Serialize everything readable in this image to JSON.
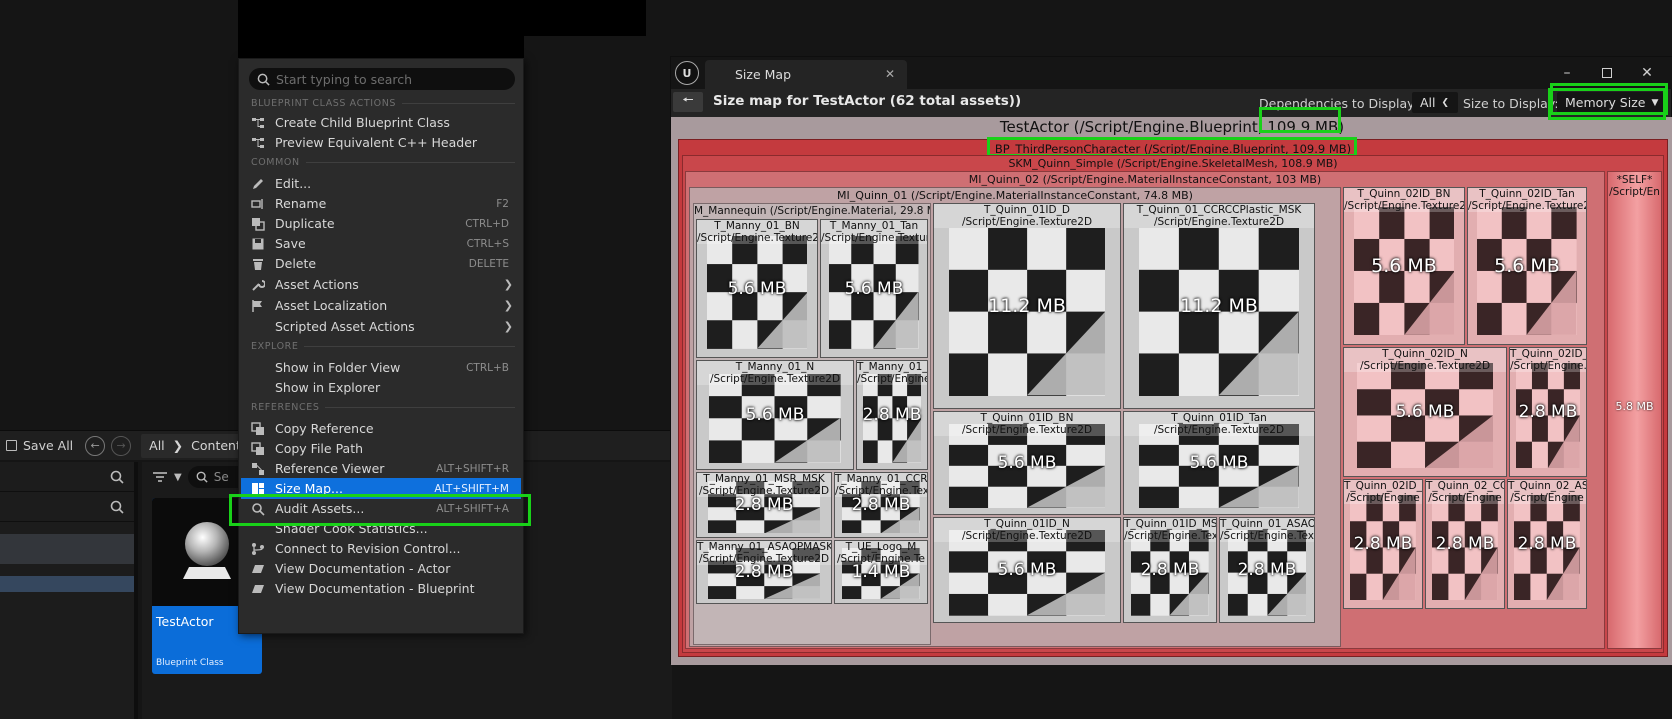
{
  "content_browser": {
    "save_all": "Save All",
    "breadcrumb": [
      "All",
      "Content"
    ],
    "search_placeholder": "Se",
    "asset": {
      "name": "TestActor",
      "type": "Blueprint Class"
    }
  },
  "context_menu": {
    "search_placeholder": "Start typing to search",
    "sections": {
      "blueprint": "BLUEPRINT CLASS ACTIONS",
      "common": "COMMON",
      "explore": "EXPLORE",
      "references": "REFERENCES"
    },
    "items": {
      "create_child": {
        "label": "Create Child Blueprint Class"
      },
      "preview_cpp": {
        "label": "Preview Equivalent C++ Header"
      },
      "edit": {
        "label": "Edit..."
      },
      "rename": {
        "label": "Rename",
        "shortcut": "F2"
      },
      "duplicate": {
        "label": "Duplicate",
        "shortcut": "CTRL+D"
      },
      "save": {
        "label": "Save",
        "shortcut": "CTRL+S"
      },
      "delete": {
        "label": "Delete",
        "shortcut": "DELETE"
      },
      "asset_actions": {
        "label": "Asset Actions"
      },
      "asset_localization": {
        "label": "Asset Localization"
      },
      "scripted_actions": {
        "label": "Scripted Asset Actions"
      },
      "show_folder": {
        "label": "Show in Folder View",
        "shortcut": "CTRL+B"
      },
      "show_explorer": {
        "label": "Show in Explorer"
      },
      "copy_reference": {
        "label": "Copy Reference"
      },
      "copy_path": {
        "label": "Copy File Path"
      },
      "reference_viewer": {
        "label": "Reference Viewer",
        "shortcut": "ALT+SHIFT+R"
      },
      "size_map": {
        "label": "Size Map...",
        "shortcut": "ALT+SHIFT+M"
      },
      "audit_assets": {
        "label": "Audit Assets...",
        "shortcut": "ALT+SHIFT+A"
      },
      "shader_cook": {
        "label": "Shader Cook Statistics..."
      },
      "revision_control": {
        "label": "Connect to Revision Control..."
      },
      "doc_actor": {
        "label": "View Documentation - Actor"
      },
      "doc_blueprint": {
        "label": "View Documentation - Blueprint"
      }
    }
  },
  "size_map": {
    "tab_title": "Size Map",
    "heading": "Size map for TestActor  (62 total assets))",
    "deps_label": "Dependencies to Display:",
    "deps_value": "All",
    "size_label": "Size to Display:",
    "size_value": "Memory Size",
    "root": {
      "name": "TestActor  (/Script/Engine.Blueprint,",
      "size": "109.9 MB)"
    },
    "bp": "BP_ThirdPersonCharacter  (/Script/Engine.Blueprint, 109.9 MB)",
    "skm": "SKM_Quinn_Simple  (/Script/Engine.SkeletalMesh, 108.9 MB)",
    "mi02": "MI_Quinn_02  (/Script/Engine.MaterialInstanceConstant, 103 MB)",
    "mi01": "MI_Quinn_01  (/Script/Engine.MaterialInstanceConstant, 74.8 MB)",
    "mmanne": "M_Mannequin  (/Script/Engine.Material, 29.8 MB)",
    "self_label": "*SELF*",
    "self_path": "/Script/En",
    "self_size": "5.8 MB",
    "textures": [
      {
        "id": "t1",
        "name": "T_Manny_01_BN",
        "path": "/Script/Engine.Texture2",
        "size": "5.6 MB"
      },
      {
        "id": "t2",
        "name": "T_Manny_01_Tan",
        "path": "/Script/Engine.Texture2",
        "size": "5.6 MB"
      },
      {
        "id": "t3",
        "name": "T_Manny_01_N",
        "path": "/Script/Engine.Texture2D",
        "size": "5.6 MB"
      },
      {
        "id": "t4",
        "name": "T_Manny_01_D",
        "path": "/Script/Engine.",
        "size": "2.8 MB"
      },
      {
        "id": "t5",
        "name": "T_Manny_01_MSR_MSK",
        "path": "/Script/Engine.Texture2D",
        "size": "2.8 MB"
      },
      {
        "id": "t6",
        "name": "T_Manny_01_CCRCC",
        "path": "/Script/Engine.Textu",
        "size": "2.8 MB"
      },
      {
        "id": "t7",
        "name": "T_Manny_01_ASAOPMASK",
        "path": "/Script/Engine.Texture2D",
        "size": "2.8 MB"
      },
      {
        "id": "t8",
        "name": "T_UE_Logo_M",
        "path": "/Script/Engine.Te",
        "size": "1.4 MB"
      },
      {
        "id": "t9",
        "name": "T_Quinn_01ID_D",
        "path": "/Script/Engine.Texture2D",
        "size": "11.2 MB"
      },
      {
        "id": "t10",
        "name": "T_Quinn_01_CCRCCPlastic_MSK",
        "path": "/Script/Engine.Texture2D",
        "size": "11.2 MB"
      },
      {
        "id": "t11",
        "name": "T_Quinn_01ID_BN",
        "path": "/Script/Engine.Texture2D",
        "size": "5.6 MB"
      },
      {
        "id": "t12",
        "name": "T_Quinn_01ID_Tan",
        "path": "/Script/Engine.Texture2D",
        "size": "5.6 MB"
      },
      {
        "id": "t13",
        "name": "T_Quinn_01ID_N",
        "path": "/Script/Engine.Texture2D",
        "size": "5.6 MB"
      },
      {
        "id": "t14",
        "name": "T_Quinn_01ID_MSR",
        "path": "/Script/Engine.Tex",
        "size": "2.8 MB"
      },
      {
        "id": "t15",
        "name": "T_Quinn_01_ASAO",
        "path": "/Script/Engine.Tex",
        "size": "2.8 MB"
      },
      {
        "id": "t16",
        "name": "T_Quinn_02ID_BN",
        "path": "/Script/Engine.Texture2",
        "size": "5.6 MB"
      },
      {
        "id": "t17",
        "name": "T_Quinn_02ID_Tan",
        "path": "/Script/Engine.Texture2",
        "size": "5.6 MB"
      },
      {
        "id": "t18",
        "name": "T_Quinn_02ID_N",
        "path": "/Script/Engine.Texture2D",
        "size": "5.6 MB"
      },
      {
        "id": "t19",
        "name": "T_Quinn_02ID_D",
        "path": "/Script/Engine.",
        "size": "2.8 MB"
      },
      {
        "id": "t20",
        "name": "T_Quinn_02ID_M",
        "path": "/Script/Engine",
        "size": "2.8 MB"
      },
      {
        "id": "t21",
        "name": "T_Quinn_02_CC",
        "path": "/Script/Engine",
        "size": "2.8 MB"
      },
      {
        "id": "t22",
        "name": "T_Quinn_02_AS",
        "path": "/Script/Engine",
        "size": "2.8 MB"
      }
    ]
  },
  "colors": {
    "accent_blue": "#0e70dd",
    "highlight_green": "#19d119",
    "treemap_red": "#c43a3e"
  }
}
